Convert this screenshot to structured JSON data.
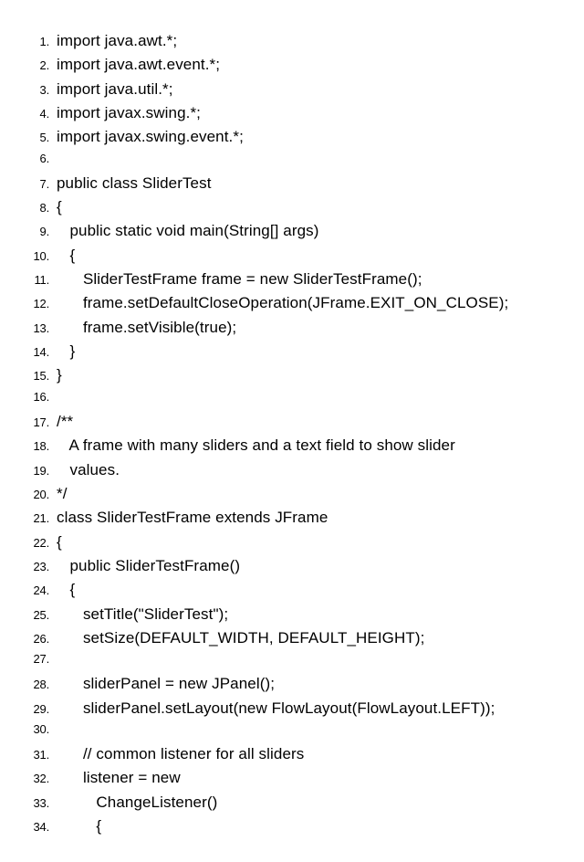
{
  "code": {
    "lines": [
      {
        "n": "1",
        "text": "import java.awt.*;"
      },
      {
        "n": "2",
        "text": "import java.awt.event.*;"
      },
      {
        "n": "3",
        "text": "import java.util.*;"
      },
      {
        "n": "4",
        "text": "import javax.swing.*;"
      },
      {
        "n": "5",
        "text": "import javax.swing.event.*;"
      },
      {
        "n": "6",
        "text": ""
      },
      {
        "n": "7",
        "text": "public class SliderTest"
      },
      {
        "n": "8",
        "text": "{"
      },
      {
        "n": "9",
        "text": "   public static void main(String[] args)"
      },
      {
        "n": "10",
        "text": "   {"
      },
      {
        "n": "11",
        "text": "      SliderTestFrame frame = new SliderTestFrame();"
      },
      {
        "n": "12",
        "text": "      frame.setDefaultCloseOperation(JFrame.EXIT_ON_CLOSE);"
      },
      {
        "n": "13",
        "text": "      frame.setVisible(true);"
      },
      {
        "n": "14",
        "text": "   }"
      },
      {
        "n": "15",
        "text": "}"
      },
      {
        "n": "16",
        "text": ""
      },
      {
        "n": "17",
        "text": "/**"
      },
      {
        "n": "18",
        "text": "   A frame with many sliders and a text field to show slider"
      },
      {
        "n": "19",
        "text": "   values."
      },
      {
        "n": "20",
        "text": "*/"
      },
      {
        "n": "21",
        "text": "class SliderTestFrame extends JFrame"
      },
      {
        "n": "22",
        "text": "{"
      },
      {
        "n": "23",
        "text": "   public SliderTestFrame()"
      },
      {
        "n": "24",
        "text": "   {"
      },
      {
        "n": "25",
        "text": "      setTitle(\"SliderTest\");"
      },
      {
        "n": "26",
        "text": "      setSize(DEFAULT_WIDTH, DEFAULT_HEIGHT);"
      },
      {
        "n": "27",
        "text": ""
      },
      {
        "n": "28",
        "text": "      sliderPanel = new JPanel();"
      },
      {
        "n": "29",
        "text": "      sliderPanel.setLayout(new FlowLayout(FlowLayout.LEFT));"
      },
      {
        "n": "30",
        "text": ""
      },
      {
        "n": "31",
        "text": "      // common listener for all sliders"
      },
      {
        "n": "32",
        "text": "      listener = new"
      },
      {
        "n": "33",
        "text": "         ChangeListener()"
      },
      {
        "n": "34",
        "text": "         {"
      }
    ]
  }
}
